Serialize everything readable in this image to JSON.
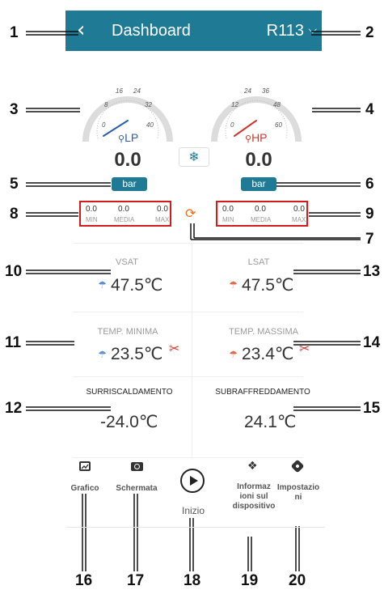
{
  "header": {
    "back_icon": "‹",
    "title": "Dashboard",
    "refrigerant": "R113",
    "chevron": "⌵"
  },
  "callouts": [
    "1",
    "2",
    "3",
    "4",
    "5",
    "6",
    "7",
    "8",
    "9",
    "10",
    "11",
    "12",
    "13",
    "14",
    "15",
    "16",
    "17",
    "18",
    "19",
    "20"
  ],
  "gauges": {
    "lp": {
      "label": "LP",
      "ticks": [
        "0",
        "8",
        "16",
        "24",
        "32",
        "40"
      ],
      "value": "0.0",
      "unit": "bar",
      "color": "#2a5db0"
    },
    "hp": {
      "label": "HP",
      "ticks": [
        "0",
        "12",
        "24",
        "36",
        "48",
        "60"
      ],
      "value": "0.0",
      "unit": "bar",
      "color": "#d0362b"
    }
  },
  "stats_left": {
    "min": "0.0",
    "media": "0.0",
    "max": "0.0",
    "min_label": "MIN",
    "media_label": "MEDIA",
    "max_label": "MAX"
  },
  "stats_right": {
    "min": "0.0",
    "media": "0.0",
    "max": "0.0",
    "min_label": "MIN",
    "media_label": "MEDIA",
    "max_label": "MAX"
  },
  "readings": {
    "vsat": {
      "label": "VSAT",
      "value": "47.5℃"
    },
    "lsat": {
      "label": "LSAT",
      "value": "47.5℃"
    },
    "tmin": {
      "label": "TEMP. MINIMA",
      "value": "23.5℃"
    },
    "tmax": {
      "label": "TEMP. MASSIMA",
      "value": "23.4℃"
    },
    "surr": {
      "label": "SURRISCALDAMENTO",
      "value": "-24.0℃"
    },
    "subr": {
      "label": "SUBRAFFREDDAMENTO",
      "value": "24.1℃"
    }
  },
  "nav": {
    "grafico": "Grafico",
    "schermata": "Schermata",
    "inizio": "Inizio",
    "info_l1": "Informaz",
    "info_l2": "ioni sul",
    "info_l3": "dispositivo",
    "impost_l1": "Impostazio",
    "impost_l2": "ni"
  },
  "colors": {
    "header": "#1f7b95",
    "callout_box": "#d21b1b",
    "lp": "#2a5db0",
    "hp": "#d0362b",
    "refresh": "#e8701a"
  }
}
